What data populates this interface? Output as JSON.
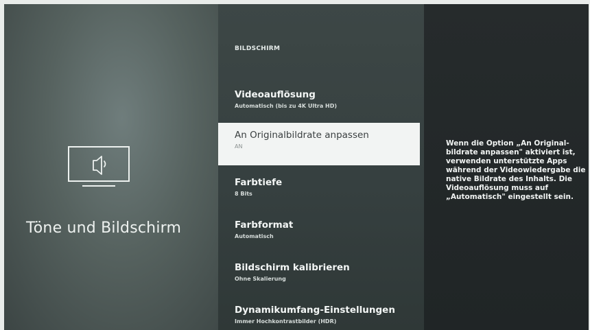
{
  "left_panel": {
    "title": "Töne und Bildschirm",
    "icon": "tv-speaker-icon"
  },
  "menu": {
    "heading": "BILDSCHIRM",
    "items": [
      {
        "title": "Videoauflösung",
        "subtitle": "Automatisch (bis zu 4K Ultra HD)",
        "selected": false
      },
      {
        "title": "An Originalbildrate anpassen",
        "subtitle": "AN",
        "selected": true
      },
      {
        "title": "Farbtiefe",
        "subtitle": "8 Bits",
        "selected": false
      },
      {
        "title": "Farbformat",
        "subtitle": "Automatisch",
        "selected": false
      },
      {
        "title": "Bildschirm kalibrieren",
        "subtitle": "Ohne Skalierung",
        "selected": false
      },
      {
        "title": "Dynamikumfang-Einstellungen",
        "subtitle": "Immer Hochkontrastbilder (HDR)",
        "selected": false
      }
    ]
  },
  "info_panel": {
    "text": "Wenn die Option „An Original-bildrate anpassen\" aktiviert ist, verwenden unterstützte Apps während der Videowiedergabe die native Bildrate des Inhalts. Die Videoauflösung muss auf „Automatisch\" eingestellt sein."
  },
  "colors": {
    "selected_bg": "#f2f4f3",
    "menu_bg": "#3a4443",
    "info_bg": "#24292a"
  }
}
